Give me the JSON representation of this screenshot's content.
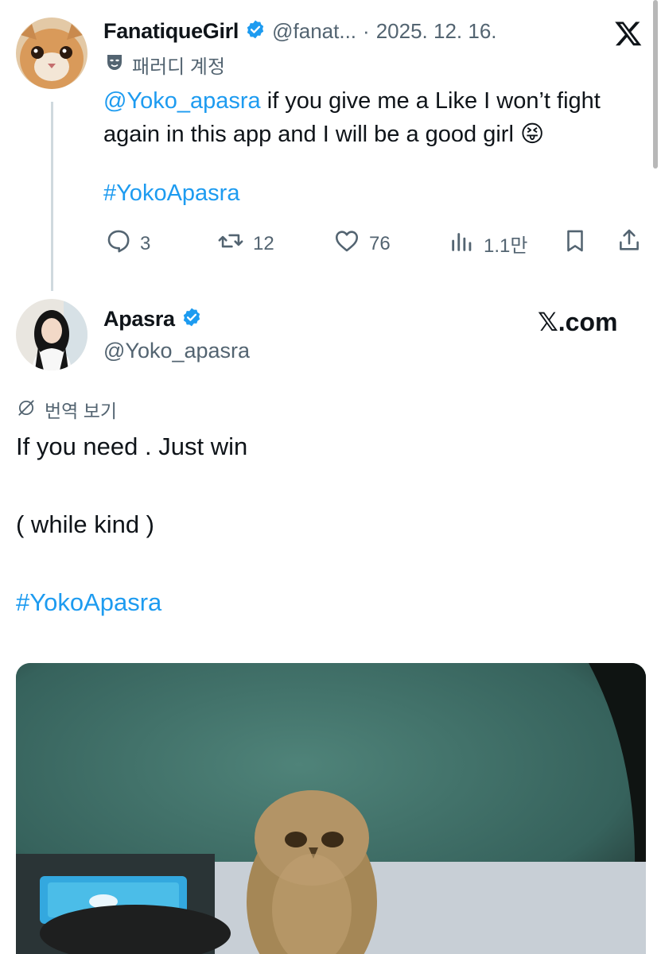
{
  "reply_tweet": {
    "display_name": "FanatiqueGirl",
    "handle": "@fanat...",
    "separator": "·",
    "date": "2025. 12. 16.",
    "parody_label": "패러디 계정",
    "mention": "@Yoko_apasra",
    "text_line1": " if you give me a Like I won’t fight",
    "text_line2": "again in this app and I will be a good girl 😝",
    "hashtag": "#YokoApasra",
    "actions": {
      "replies": "3",
      "retweets": "12",
      "likes": "76",
      "views": "1.1만"
    }
  },
  "main_tweet": {
    "display_name": "Apasra",
    "handle": "@Yoko_apasra",
    "watermark": "𝕏.com",
    "translate_label": "번역 보기",
    "line1": "If you need . Just win",
    "line2": "( while kind )",
    "hashtag": "#YokoApasra"
  },
  "colors": {
    "accent": "#1d9bf0",
    "text": "#0f1419",
    "muted": "#536471"
  }
}
